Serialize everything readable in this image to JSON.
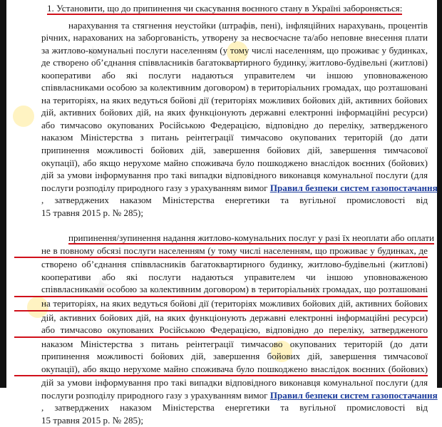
{
  "heading": "1. Установити, що до припинення чи скасування воєнного стану в Україні забороняється:",
  "paragraph_1": {
    "lines": [
      "нарахування та стягнення неустойки (штрафів, пені), інфляційних нарахувань, процентів",
      "річних, нарахованих на заборгованість, утворену за несвоєчасне та/або неповне внесення плати",
      "за житлово-комунальні послуги населенням (у тому числі населенням, що проживає у будинках,",
      "де створено об’єднання співвласників багатоквартирного будинку, житлово-будівельні (житлові)",
      "кооперативи або які послуги надаються управителем чи іншою уповноваженою",
      "співвласниками особою за колективним договором) в територіальних громадах, що розташовані",
      "на територіях, на яких ведуться бойові дії (територіях можливих бойових дій, активних бойових",
      "дій, активних бойових дій, на яких функціонують державні електронні інформаційні ресурси)",
      "або тимчасово окупованих Російською Федерацією, відповідно до переліку, затвердженого",
      "наказом Міністерства з питань реінтеграції тимчасово окупованих територій (до дати",
      "припинення можливості бойових дій, завершення бойових дій, завершення тимчасової",
      "окупації), або якщо нерухоме майно споживача було пошкоджено внаслідок воєнних (бойових)",
      "дій за умови інформування про такі випадки відповідного виконавця комунальної послуги (для",
      "послуги розподілу природного газу з урахуванням вимог"
    ],
    "link": "Правил безпеки систем газопостачання",
    "tail_1": ", затверджених наказом Міністерства енергетики та вугільної промисловості від",
    "tail_2": "15 травня 2015 р. № 285);"
  },
  "paragraph_2": {
    "lines": [
      "припинення/зупинення надання житлово-комунальних послуг у разі їх неоплати або оплати",
      "не в повному обсязі послуги населенням (у тому числі населенням, що проживає у будинках, де",
      "створено об’єднання співвласників багатоквартирного будинку, житлово-будівельні (житлові)",
      "кооперативи або які послуги надаються управителем чи іншою уповноваженою",
      "співвласниками особою за колективним договором) в територіальних громадах, що розташовані",
      "на територіях, на яких ведуться бойові дії (територіях можливих бойових дій, активних бойових",
      "дій, активних бойових дій, на яких функціонують державні електронні інформаційні ресурси)",
      "або тимчасово окупованих Російською Федерацією, відповідно до переліку, затвердженого",
      "наказом Міністерства з питань реінтеграції тимчасово окупованих територій (до дати",
      "припинення можливості бойових дій, завершення бойових дій, завершення тимчасової",
      "окупації), або якщо нерухоме майно споживача було пошкоджено внаслідок воєнних (бойових)",
      "дій за умови інформування про такі випадки відповідного виконавця комунальної послуги (для",
      "послуги розподілу природного газу з урахуванням вимог"
    ],
    "link": "Правил безпеки систем газопостачання",
    "tail_1": ", затверджених наказом Міністерства енергетики та вугільної промисловості від",
    "tail_2": "15 травня 2015 р. № 285);"
  },
  "colors": {
    "underline": "#d0101a",
    "link": "#1a3a9a",
    "text": "#1a1a1a"
  }
}
